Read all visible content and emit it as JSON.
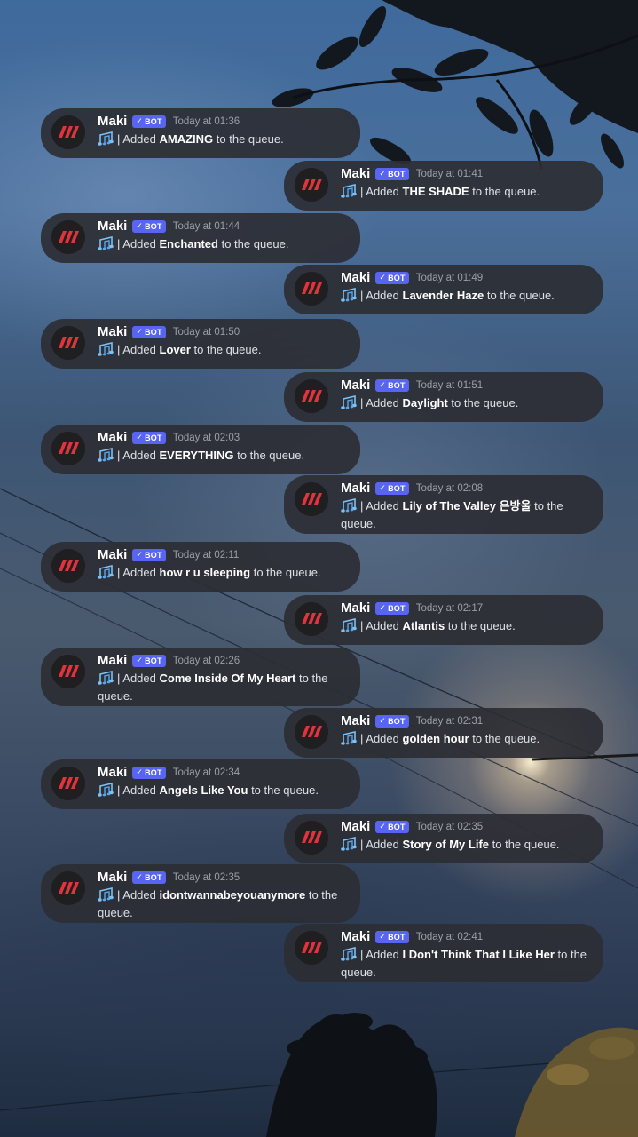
{
  "bot": {
    "name": "Maki",
    "badge": "BOT",
    "added_prefix": "| Added",
    "added_suffix": "to the queue."
  },
  "colors": {
    "bubble": "#2c2e34",
    "badge": "#5865f2",
    "avatar_logo": "#e0343d",
    "name": "#ffffff",
    "text": "#dde1e6",
    "time": "#9aa0a8"
  },
  "icons": {
    "avatar": "maki-logo-icon",
    "music": "music-notes-icon",
    "badge_check": "check-icon"
  },
  "messages": [
    {
      "time": "Today at 01:36",
      "song": "AMAZING",
      "side": "left"
    },
    {
      "time": "Today at 01:41",
      "song": "THE SHADE",
      "side": "right"
    },
    {
      "time": "Today at 01:44",
      "song": "Enchanted",
      "side": "left"
    },
    {
      "time": "Today at 01:49",
      "song": "Lavender Haze",
      "side": "right"
    },
    {
      "time": "Today at 01:50",
      "song": "Lover",
      "side": "left"
    },
    {
      "time": "Today at 01:51",
      "song": "Daylight",
      "side": "right"
    },
    {
      "time": "Today at 02:03",
      "song": "EVERYTHING",
      "side": "left"
    },
    {
      "time": "Today at 02:08",
      "song": "Lily of The Valley 은방울",
      "side": "right"
    },
    {
      "time": "Today at 02:11",
      "song": "how r u sleeping",
      "side": "left"
    },
    {
      "time": "Today at 02:17",
      "song": "Atlantis",
      "side": "right"
    },
    {
      "time": "Today at 02:26",
      "song": "Come Inside Of My Heart",
      "side": "left"
    },
    {
      "time": "Today at 02:31",
      "song": "golden hour",
      "side": "right"
    },
    {
      "time": "Today at 02:34",
      "song": "Angels Like You",
      "side": "left"
    },
    {
      "time": "Today at 02:35",
      "song": "Story of My Life",
      "side": "right"
    },
    {
      "time": "Today at 02:35",
      "song": "idontwannabeyouanymore",
      "side": "left"
    },
    {
      "time": "Today at 02:41",
      "song": "I Don't Think That I Like Her",
      "side": "right"
    }
  ]
}
